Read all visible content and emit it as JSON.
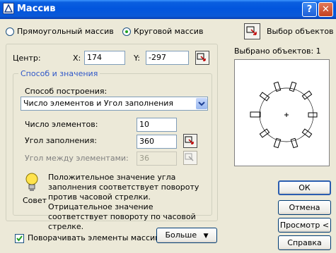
{
  "window": {
    "title": "Массив"
  },
  "mode": {
    "rect_label": "Прямоугольный массив",
    "polar_label": "Круговой массив",
    "selected": "polar"
  },
  "select_objects": {
    "label": "Выбор объектов",
    "count_text": "Выбрано объектов: 1"
  },
  "center": {
    "label": "Центр:",
    "x_label": "X:",
    "x_value": "174",
    "y_label": "Y:",
    "y_value": "-297"
  },
  "method": {
    "group_title": "Способ и значения",
    "build_label": "Способ построения:",
    "build_value": "Число элементов и Угол заполнения",
    "count_label": "Число элементов:",
    "count_value": "10",
    "fill_label": "Угол заполнения:",
    "fill_value": "360",
    "between_label": "Угол между элементами:",
    "between_value": "36"
  },
  "tip": {
    "icon_label": "Совет",
    "text": "Положительное значение угла заполнения соответствует повороту против часовой стрелки. Отрицательное значение соответствует повороту по часовой стрелке."
  },
  "rotate": {
    "label": "Поворачивать элементы массива",
    "checked": true
  },
  "buttons": {
    "more": "Больше",
    "ok": "ОК",
    "cancel": "Отмена",
    "preview": "Просмотр <",
    "help": "Справка"
  },
  "colors": {
    "title_bar": "#0a5fe0",
    "group_title": "#2f57c8",
    "default_border": "#2a5db0"
  }
}
